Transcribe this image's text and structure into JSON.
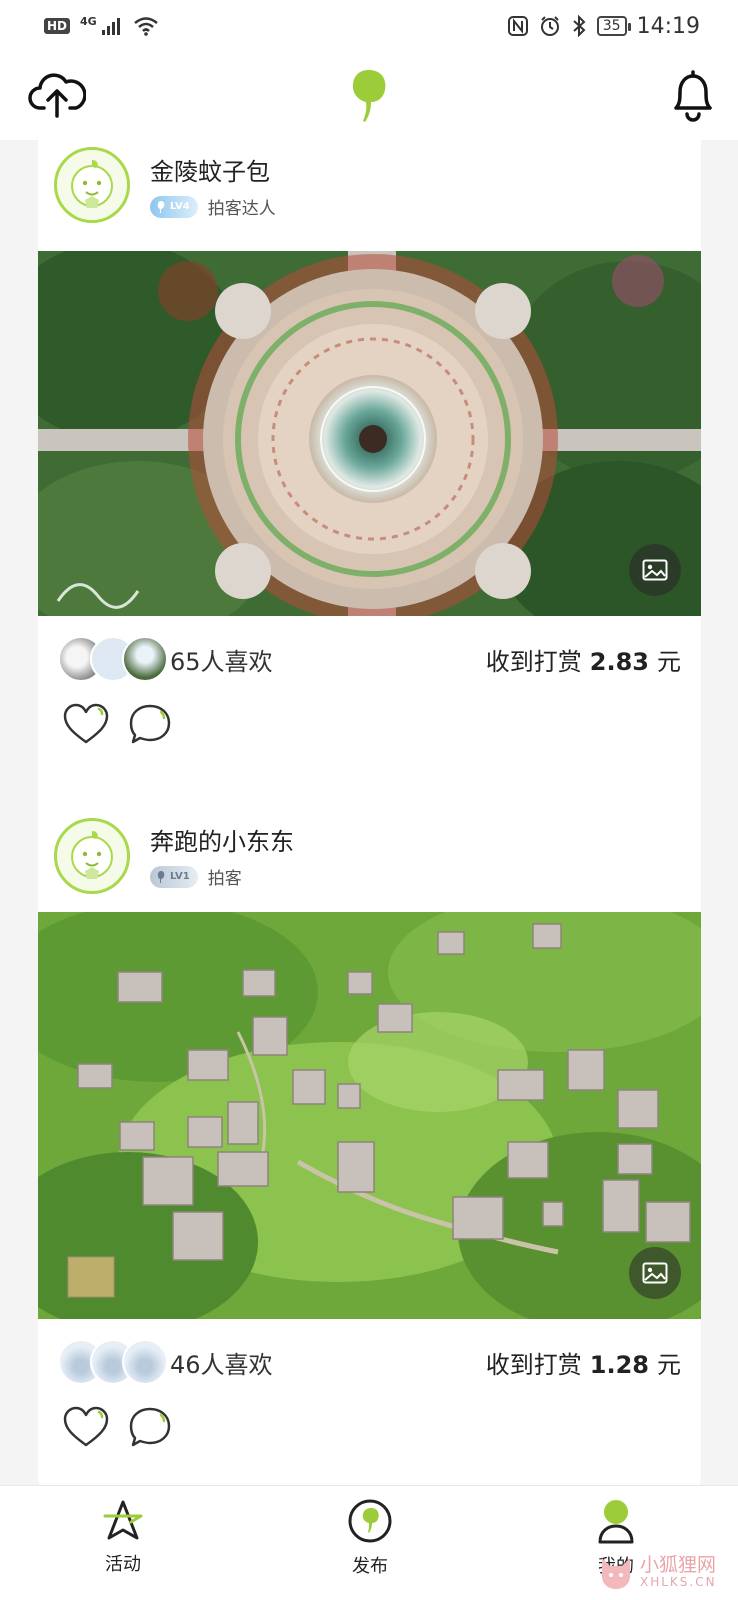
{
  "status_bar": {
    "hd": "HD",
    "network": "4G",
    "battery": "35",
    "time": "14:19"
  },
  "header": {
    "upload_icon": "cloud-upload-icon",
    "logo_icon": "leaf-logo-icon",
    "notification_icon": "bell-icon"
  },
  "feed": {
    "posts": [
      {
        "user_name": "金陵蚊子包",
        "level": "LV4",
        "level_title": "拍客达人",
        "likes_text": "65人喜欢",
        "reward_label": "收到打赏",
        "reward_amount": "2.83",
        "reward_unit": "元"
      },
      {
        "user_name": "奔跑的小东东",
        "level": "LV1",
        "level_title": "拍客",
        "likes_text": "46人喜欢",
        "reward_label": "收到打赏",
        "reward_amount": "1.28",
        "reward_unit": "元"
      }
    ]
  },
  "bottom_nav": {
    "items": [
      {
        "label": "活动",
        "icon": "compass-star-icon"
      },
      {
        "label": "发布",
        "icon": "publish-leaf-icon"
      },
      {
        "label": "我的",
        "icon": "profile-icon"
      }
    ]
  },
  "watermark": {
    "cn": "小狐狸网",
    "en": "XHLKS.CN"
  },
  "colors": {
    "brand_green": "#9ccc3a",
    "card_bg": "#ffffff",
    "page_bg": "#f4f4f4"
  }
}
